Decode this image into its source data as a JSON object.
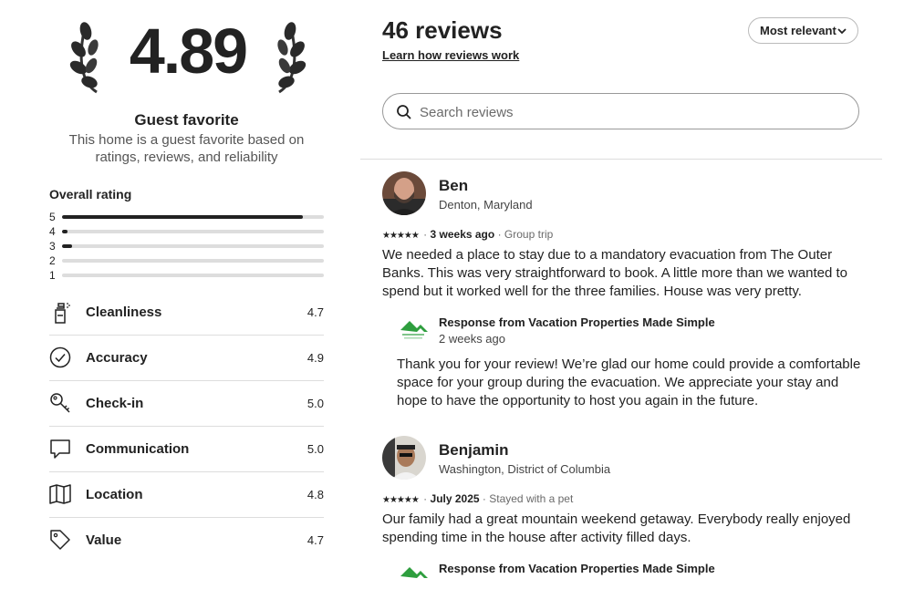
{
  "rating": {
    "score": "4.89",
    "title": "Guest favorite",
    "description": "This home is a guest favorite based on ratings, reviews, and reliability"
  },
  "overall": {
    "title": "Overall rating",
    "bars": [
      {
        "label": "5",
        "fraction": 0.92
      },
      {
        "label": "4",
        "fraction": 0.02
      },
      {
        "label": "3",
        "fraction": 0.04
      },
      {
        "label": "2",
        "fraction": 0
      },
      {
        "label": "1",
        "fraction": 0
      }
    ]
  },
  "categories": [
    {
      "name": "Cleanliness",
      "value": "4.7",
      "icon": "spray-bottle-icon"
    },
    {
      "name": "Accuracy",
      "value": "4.9",
      "icon": "check-circle-icon"
    },
    {
      "name": "Check-in",
      "value": "5.0",
      "icon": "key-icon"
    },
    {
      "name": "Communication",
      "value": "5.0",
      "icon": "chat-bubble-icon"
    },
    {
      "name": "Location",
      "value": "4.8",
      "icon": "map-icon"
    },
    {
      "name": "Value",
      "value": "4.7",
      "icon": "tag-icon"
    }
  ],
  "header": {
    "count_label": "46 reviews",
    "learn_link": "Learn how reviews work",
    "sort_label": "Most relevant"
  },
  "search": {
    "placeholder": "Search reviews"
  },
  "reviews": [
    {
      "name": "Ben",
      "location": "Denton, Maryland",
      "stars": "★★★★★",
      "date": "3 weeks ago",
      "trip": "Group trip",
      "text": "We needed a place to stay due to a mandatory evacuation from The Outer Banks. This was very straightforward to book.  A little more than we wanted to spend but it worked well for the three families.  House was very pretty.",
      "response": {
        "from": "Response from Vacation Properties Made Simple",
        "date": "2 weeks ago",
        "text": "Thank you for your review! We’re glad our home could provide a comfortable space for your group during the evacuation. We appreciate your stay and hope to have the opportunity to host you again in the future."
      }
    },
    {
      "name": "Benjamin",
      "location": "Washington, District of Columbia",
      "stars": "★★★★★",
      "date": "July 2025",
      "trip": "Stayed with a pet",
      "text": "Our family had a great mountain weekend getaway.  Everybody really enjoyed spending time in the house after activity filled days.",
      "response": {
        "from": "Response from Vacation Properties Made Simple"
      }
    }
  ],
  "colors": {
    "text": "#222222",
    "muted": "#6a6a6a",
    "divider": "#dddddd",
    "logo_green": "#2e9e3e"
  }
}
